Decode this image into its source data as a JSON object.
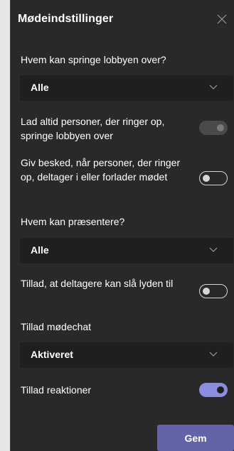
{
  "panel": {
    "title": "Mødeindstillinger",
    "close_icon": "close-icon"
  },
  "settings": {
    "lobby_bypass": {
      "label": "Hvem kan springe lobbyen over?",
      "selected": "Alle"
    },
    "dial_in_bypass": {
      "label": "Lad altid personer, der ringer op, springe lobbyen over",
      "state": "disabled"
    },
    "notify_dial_in": {
      "label": "Giv besked, når personer, der ringer op, deltager i eller forlader mødet",
      "state": "off"
    },
    "presenters": {
      "label": "Hvem kan præsentere?",
      "selected": "Alle"
    },
    "unmute": {
      "label": "Tillad, at deltagere kan slå lyden til",
      "state": "off"
    },
    "meeting_chat": {
      "label": "Tillad mødechat",
      "selected": "Aktiveret"
    },
    "reactions": {
      "label": "Tillad reaktioner",
      "state": "on"
    }
  },
  "footer": {
    "save_label": "Gem"
  },
  "colors": {
    "panel_bg": "#292929",
    "field_bg": "#1f1f1f",
    "accent": "#6264a7",
    "toggle_on": "#8a8ee0"
  }
}
